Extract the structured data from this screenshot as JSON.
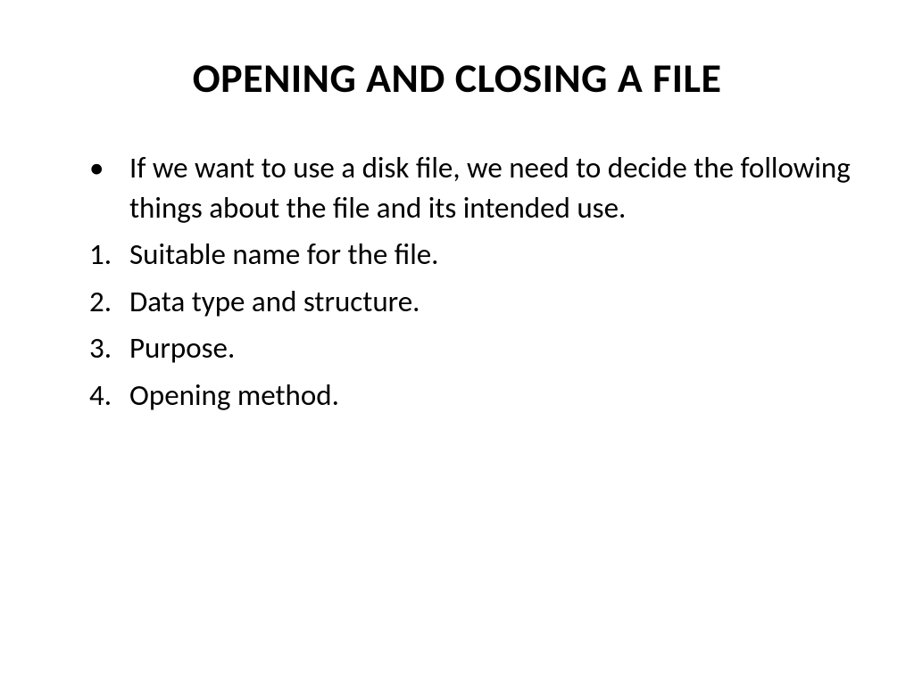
{
  "slide": {
    "title": "OPENING AND CLOSING A FILE",
    "bullet_intro": "If we want to use a disk file, we need to decide the following things about the file and its intended use.",
    "numbered_items": [
      "Suitable name for the file.",
      "Data type and structure.",
      "Purpose.",
      "Opening method."
    ]
  }
}
